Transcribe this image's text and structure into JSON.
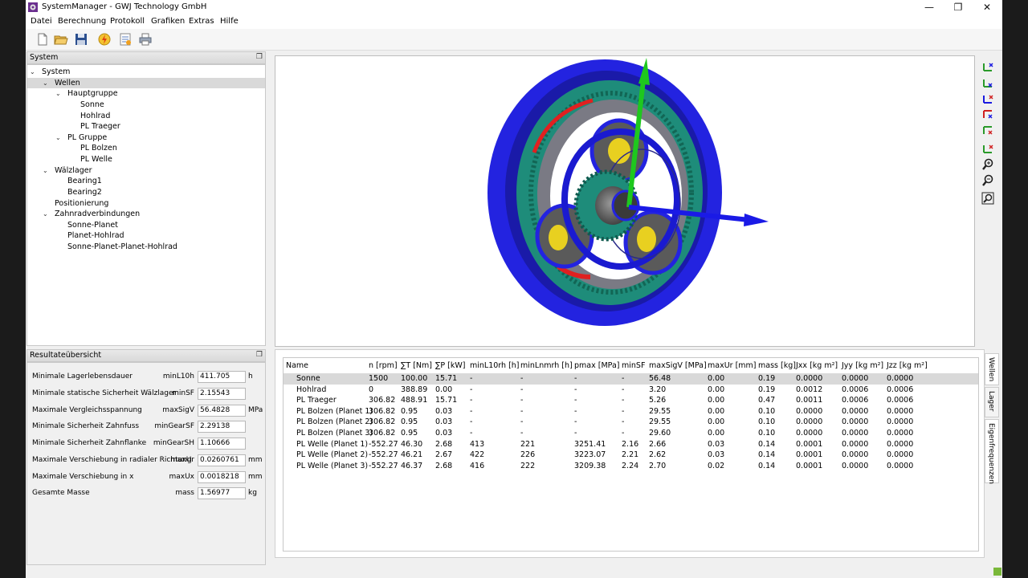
{
  "window": {
    "title": "SystemManager - GWJ Technology GmbH",
    "minimize": "—",
    "restore": "❐",
    "close": "✕"
  },
  "menu": [
    "Datei",
    "Berechnung",
    "Protokoll",
    "Grafiken",
    "Extras",
    "Hilfe"
  ],
  "toolbar": {
    "icons": [
      "new-file-icon",
      "open-folder-icon",
      "save-icon",
      "calculate-lightning-icon",
      "report-icon",
      "print-icon"
    ]
  },
  "system_panel": {
    "title": "System",
    "tree": [
      {
        "label": "System",
        "level": 0,
        "expanded": true
      },
      {
        "label": "Wellen",
        "level": 1,
        "expanded": true,
        "selected": true
      },
      {
        "label": "Hauptgruppe",
        "level": 2,
        "expanded": true
      },
      {
        "label": "Sonne",
        "level": 3
      },
      {
        "label": "Hohlrad",
        "level": 3
      },
      {
        "label": "PL Traeger",
        "level": 3
      },
      {
        "label": "PL Gruppe",
        "level": 2,
        "expanded": true
      },
      {
        "label": "PL Bolzen",
        "level": 3
      },
      {
        "label": "PL Welle",
        "level": 3
      },
      {
        "label": "Wälzlager",
        "level": 1,
        "expanded": true
      },
      {
        "label": "Bearing1",
        "level": 2
      },
      {
        "label": "Bearing2",
        "level": 2
      },
      {
        "label": "Positionierung",
        "level": 1
      },
      {
        "label": "Zahnradverbindungen",
        "level": 1,
        "expanded": true
      },
      {
        "label": "Sonne-Planet",
        "level": 2
      },
      {
        "label": "Planet-Hohlrad",
        "level": 2
      },
      {
        "label": "Sonne-Planet-Planet-Hohlrad",
        "level": 2
      }
    ]
  },
  "results_panel": {
    "title": "Resultateübersicht",
    "rows": [
      {
        "label": "Minimale Lagerlebensdauer",
        "key": "minL10h",
        "value": "411.705",
        "unit": "h"
      },
      {
        "label": "Minimale statische Sicherheit Wälzlager",
        "key": "minSF",
        "value": "2.15543",
        "unit": ""
      },
      {
        "label": "Maximale Vergleichsspannung",
        "key": "maxSigV",
        "value": "56.4828",
        "unit": "MPa"
      },
      {
        "label": "Minimale Sicherheit Zahnfuss",
        "key": "minGearSF",
        "value": "2.29138",
        "unit": ""
      },
      {
        "label": "Minimale Sicherheit Zahnflanke",
        "key": "minGearSH",
        "value": "1.10666",
        "unit": ""
      },
      {
        "label": "Maximale Verschiebung in radialer Richtung",
        "key": "maxUr",
        "value": "0.0260761",
        "unit": "mm"
      },
      {
        "label": "Maximale Verschiebung in x",
        "key": "maxUx",
        "value": "0.0018218",
        "unit": "mm"
      },
      {
        "label": "Gesamte Masse",
        "key": "mass",
        "value": "1.56977",
        "unit": "kg"
      }
    ]
  },
  "table": {
    "columns": [
      "Name",
      "n [rpm]",
      "∑T [Nm]",
      "∑P [kW]",
      "minL10rh [h]",
      "minLnmrh [h]",
      "pmax [MPa]",
      "minSF",
      "maxSigV [MPa]",
      "maxUr [mm]",
      "mass [kg]",
      "Jxx [kg m²]",
      "Jyy [kg m²]",
      "Jzz [kg m²]"
    ],
    "rows": [
      [
        "Sonne",
        "1500",
        "100.00",
        "15.71",
        "-",
        "-",
        "-",
        "-",
        "56.48",
        "0.00",
        "0.19",
        "0.0000",
        "0.0000",
        "0.0000"
      ],
      [
        "Hohlrad",
        "0",
        "388.89",
        "0.00",
        "-",
        "-",
        "-",
        "-",
        "3.20",
        "0.00",
        "0.19",
        "0.0012",
        "0.0006",
        "0.0006"
      ],
      [
        "PL Traeger",
        "306.82",
        "488.91",
        "15.71",
        "-",
        "-",
        "-",
        "-",
        "5.26",
        "0.00",
        "0.47",
        "0.0011",
        "0.0006",
        "0.0006"
      ],
      [
        "PL Bolzen (Planet 1)",
        "306.82",
        "0.95",
        "0.03",
        "-",
        "-",
        "-",
        "-",
        "29.55",
        "0.00",
        "0.10",
        "0.0000",
        "0.0000",
        "0.0000"
      ],
      [
        "PL Bolzen (Planet 2)",
        "306.82",
        "0.95",
        "0.03",
        "-",
        "-",
        "-",
        "-",
        "29.55",
        "0.00",
        "0.10",
        "0.0000",
        "0.0000",
        "0.0000"
      ],
      [
        "PL Bolzen (Planet 3)",
        "306.82",
        "0.95",
        "0.03",
        "-",
        "-",
        "-",
        "-",
        "29.60",
        "0.00",
        "0.10",
        "0.0000",
        "0.0000",
        "0.0000"
      ],
      [
        "PL Welle (Planet 1)",
        "-552.27",
        "46.30",
        "2.68",
        "413",
        "221",
        "3251.41",
        "2.16",
        "2.66",
        "0.03",
        "0.14",
        "0.0001",
        "0.0000",
        "0.0000"
      ],
      [
        "PL Welle (Planet 2)",
        "-552.27",
        "46.21",
        "2.67",
        "422",
        "226",
        "3223.07",
        "2.21",
        "2.62",
        "0.03",
        "0.14",
        "0.0001",
        "0.0000",
        "0.0000"
      ],
      [
        "PL Welle (Planet 3)",
        "-552.27",
        "46.37",
        "2.68",
        "416",
        "222",
        "3209.38",
        "2.24",
        "2.70",
        "0.02",
        "0.14",
        "0.0001",
        "0.0000",
        "0.0000"
      ]
    ]
  },
  "side_tabs": [
    "Wellen",
    "Lager",
    "Eigenfrequenzen"
  ],
  "view_tools": [
    "view-iso-icon",
    "view-front-icon",
    "view-top-icon",
    "view-side-icon",
    "view-back-icon",
    "view-bottom-icon",
    "zoom-in-icon",
    "zoom-out-icon",
    "zoom-fit-icon"
  ],
  "colors": {
    "gear_blue": "#1a1ae6",
    "gear_teal": "#1e8c7a",
    "arrow_green": "#1ec81e",
    "selection": "#d9d9d9"
  }
}
